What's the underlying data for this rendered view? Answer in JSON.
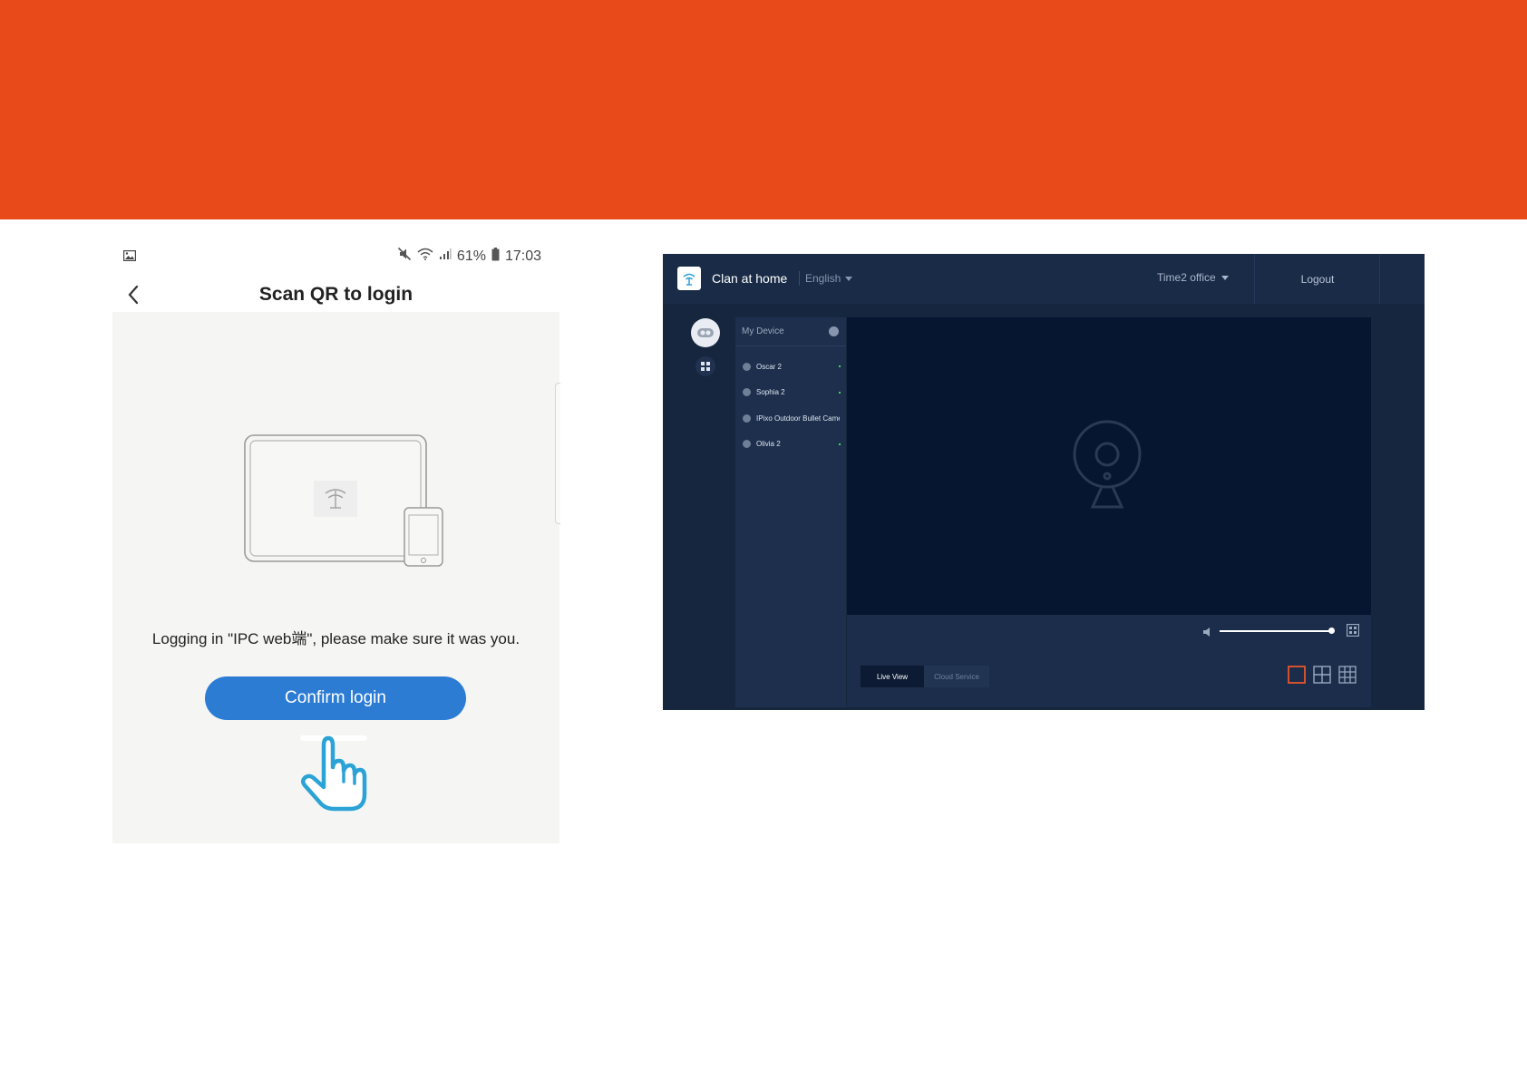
{
  "banner": {
    "color": "#e84b19"
  },
  "phone": {
    "status_bar": {
      "battery": "61%",
      "time": "17:03",
      "icons": [
        "image-icon",
        "mute-icon",
        "wifi-icon",
        "signal-icon",
        "battery-icon"
      ]
    },
    "title": "Scan QR to login",
    "message": "Logging in \"IPC web端\", please make sure it was you.",
    "confirm_label": "Confirm login",
    "accent": "#2c7cd4"
  },
  "web": {
    "app_title": "Clan at home",
    "language": "English",
    "office": "Time2 office",
    "logout": "Logout",
    "device_panel_title": "My Device",
    "devices": [
      {
        "name": "Oscar 2",
        "online": true
      },
      {
        "name": "Sophia 2",
        "online": true
      },
      {
        "name": "IPixo Outdoor Bullet Came",
        "online": false
      },
      {
        "name": "Olivia 2",
        "online": true
      }
    ],
    "volume": 0.97,
    "tabs": {
      "live_view": "Live View",
      "cloud_service": "Cloud Service"
    },
    "layouts": [
      "1x1",
      "2x2",
      "3x3"
    ],
    "selected_layout": "1x1"
  }
}
